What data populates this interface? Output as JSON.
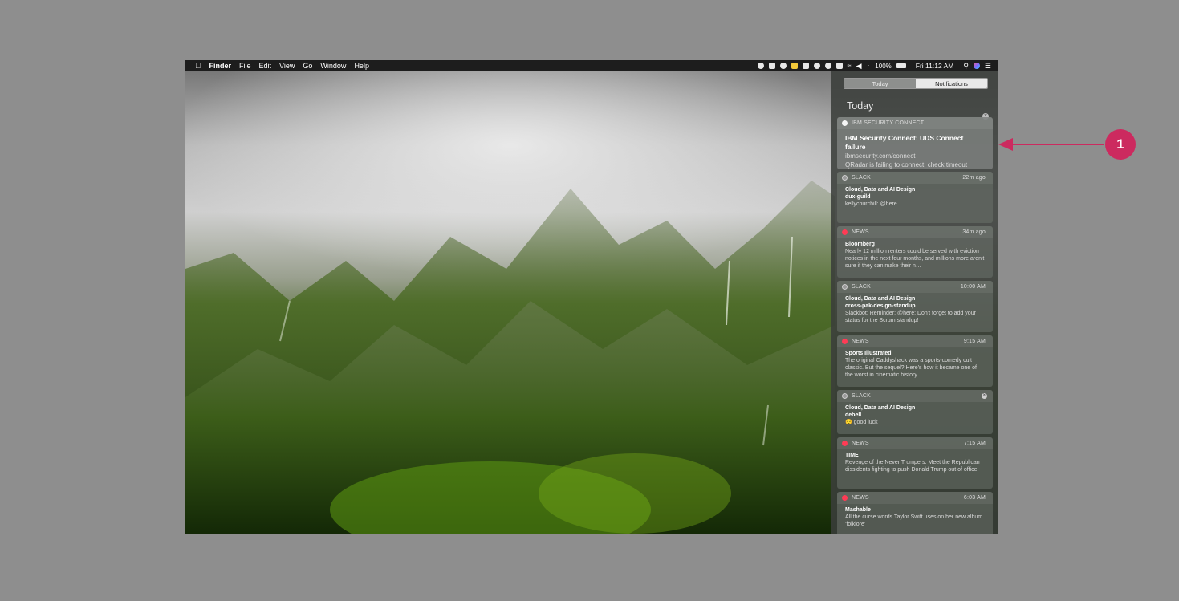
{
  "menubar": {
    "apple": "",
    "app": "Finder",
    "menus": [
      "File",
      "Edit",
      "View",
      "Go",
      "Window",
      "Help"
    ],
    "battery": "100%",
    "clock": "Fri 11:12 AM"
  },
  "notification_center": {
    "tabs": [
      "Today",
      "Notifications"
    ],
    "active_tab": "Notifications",
    "section_title": "Today",
    "notifications": [
      {
        "app": "IBM SECURITY CONNECT",
        "time": "",
        "title": "IBM Security Connect: UDS Connect failure",
        "subtitle": "ibmsecurity.com/connect",
        "message": "QRadar is failing to connect, check timeout"
      },
      {
        "app": "SLACK",
        "time": "22m ago",
        "title": "Cloud, Data and AI Design",
        "subtitle": "dux-guild",
        "message": "kellychurchill: @here…"
      },
      {
        "app": "NEWS",
        "time": "34m ago",
        "title": "Bloomberg",
        "subtitle": "",
        "message": "Nearly 12 million renters could be served with eviction notices in the next four months, and millions more aren't sure if they can make their n…"
      },
      {
        "app": "SLACK",
        "time": "10:00 AM",
        "title": "Cloud, Data and AI Design",
        "subtitle": "cross-pak-design-standup",
        "message": "Slackbot: Reminder: @here: Don't forget to add your status for the Scrum standup!"
      },
      {
        "app": "NEWS",
        "time": "9:15 AM",
        "title": "Sports Illustrated",
        "subtitle": "",
        "message": "The original Caddyshack was a sports-comedy cult classic. But the sequel? Here's how it became one of the worst in cinematic history."
      },
      {
        "app": "SLACK",
        "time": "",
        "title": "Cloud, Data and AI Design",
        "subtitle": "debell",
        "message": "😌 good luck"
      },
      {
        "app": "NEWS",
        "time": "7:15 AM",
        "title": "TIME",
        "subtitle": "",
        "message": "Revenge of the Never Trumpers: Meet the Republican dissidents fighting to push Donald Trump out of office"
      },
      {
        "app": "NEWS",
        "time": "6:03 AM",
        "title": "Mashable",
        "subtitle": "",
        "message": "All the curse words Taylor Swift uses on her new album 'folklore'"
      }
    ]
  },
  "callout": {
    "number": "1",
    "color": "#cc2a5f"
  }
}
